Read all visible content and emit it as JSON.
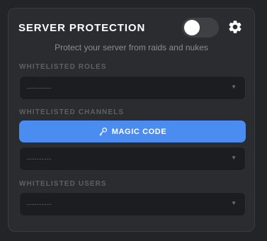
{
  "header": {
    "title": "SERVER PROTECTION",
    "subtitle": "Protect your server from raids and nukes",
    "toggle_on": false,
    "accent": "#4b8cf0"
  },
  "sections": {
    "roles": {
      "label": "WHITELISTED ROLES",
      "value": "----------"
    },
    "channels": {
      "label": "WHITELISTED CHANNELS",
      "value": "----------",
      "button_label": "MAGIC CODE"
    },
    "users": {
      "label": "WHITELISTED USERS",
      "value": "----------"
    }
  },
  "icons": {
    "settings": "gear-icon",
    "dropdown": "chevron-down-icon",
    "button": "key-icon"
  }
}
